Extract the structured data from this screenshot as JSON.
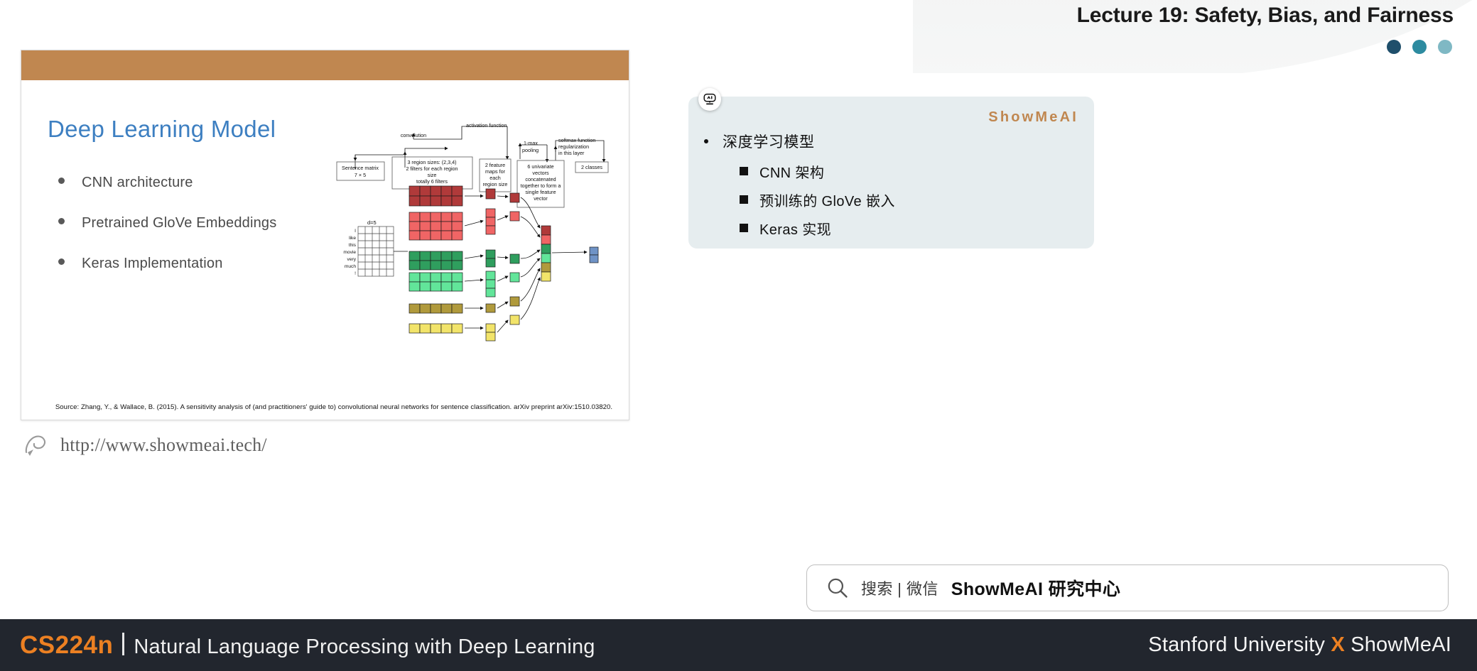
{
  "header": {
    "lecture_title": "Lecture 19: Safety, Bias, and Fairness",
    "dots": [
      {
        "name": "dot-dark",
        "color": "#1f4f6b"
      },
      {
        "name": "dot-mid",
        "color": "#2d8ba0"
      },
      {
        "name": "dot-light",
        "color": "#7fb8c4"
      }
    ]
  },
  "slide": {
    "topbar_color": "#c08750",
    "title": "Deep Learning Model",
    "title_color": "#3d7fc1",
    "bullets": [
      "CNN architecture",
      "Pretrained GloVe Embeddings",
      "Keras Implementation"
    ],
    "citation": "Source: Zhang, Y., & Wallace, B. (2015). A sensitivity analysis of (and practitioners' guide to) convolutional neural networks for sentence classification. arXiv preprint arXiv:1510.03820."
  },
  "diagram": {
    "labels": {
      "convolution": "convolution",
      "activation_function": "activation function",
      "one_max_pooling": "1-max\npooling",
      "softmax": "softmax function\nregularization\nin this layer",
      "sentence_matrix": "Sentence matrix\n7 × 5",
      "region_sizes": "3 region sizes: (2,3,4)\n2 filters for each region\nsize\ntotally 6 filters",
      "feature_maps": "2 feature\nmaps for\neach\nregion size",
      "univariate": "6 univariate\nvectors\nconcatenated\ntogether to form a\nsingle feature\nvector",
      "classes": "2 classes",
      "d_label": "d=5",
      "words": [
        "I",
        "like",
        "this",
        "movie",
        "very",
        "much",
        "!"
      ]
    },
    "colors": {
      "dark_red": "#b03a3a",
      "red": "#f06565",
      "dark_green": "#2f9e5e",
      "green": "#62e59a",
      "olive": "#b09a3c",
      "yellow": "#f2e46a",
      "blue": "#6f93c6"
    }
  },
  "url_bar": {
    "icon": "pen-cursor-icon",
    "url": "http://www.showmeai.tech/"
  },
  "notes": {
    "avatar_icon": "ai-robot-icon",
    "brand": "ShowMeAI",
    "brand_color": "#c08750",
    "top_bullet": "深度学习模型",
    "sub_bullets": [
      "CNN 架构",
      "预训练的 GloVe 嵌入",
      "Keras 实现"
    ]
  },
  "search": {
    "icon": "search-icon",
    "terms": "搜索 | 微信",
    "brand": "ShowMeAI 研究中心"
  },
  "footer": {
    "course_code": "CS224n",
    "course_name": "Natural Language Processing with Deep Learning",
    "affiliation_left": "Stanford University",
    "affiliation_x": "X",
    "affiliation_right": "ShowMeAI",
    "accent_color": "#ec8022",
    "background": "#22262e"
  }
}
